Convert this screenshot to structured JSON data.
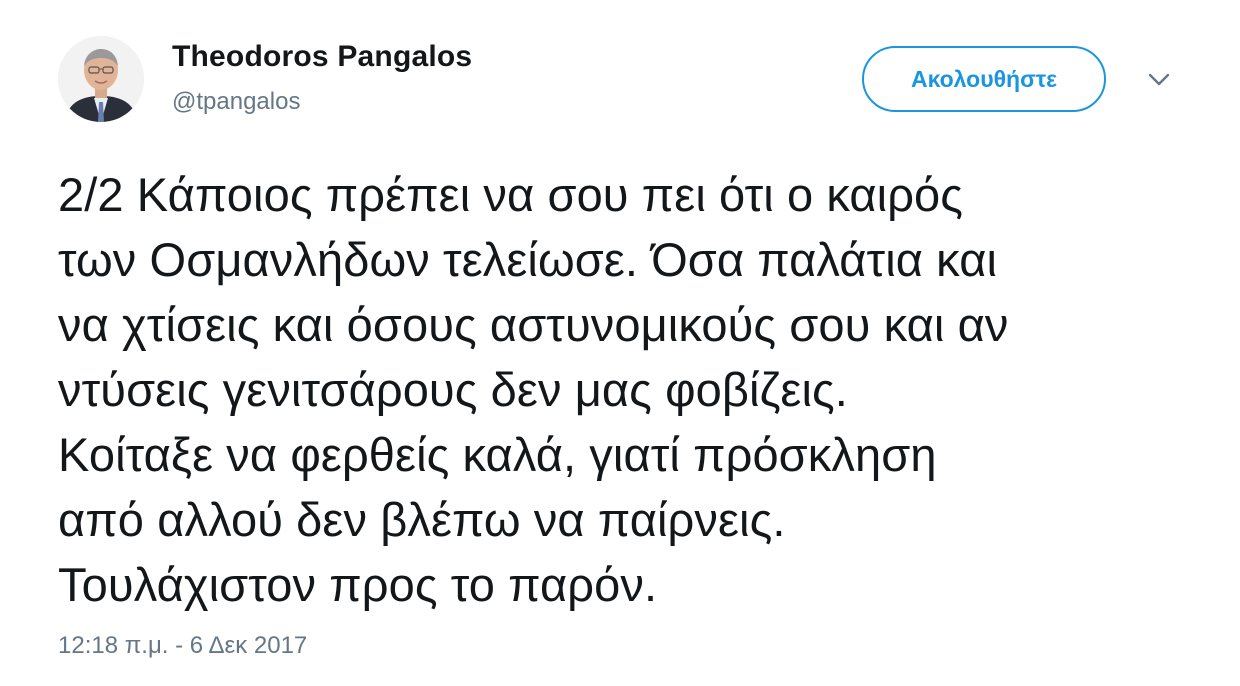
{
  "author": {
    "name": "Theodoros Pangalos",
    "handle": "@tpangalos",
    "avatar_icon": "profile-photo"
  },
  "actions": {
    "follow_label": "Ακολουθήστε",
    "more_icon": "chevron-down-icon"
  },
  "tweet": {
    "lines": [
      "2/2 Κάποιος πρέπει να σου πει ότι ο καιρός",
      "των Οσμανλήδων τελείωσε. Όσα παλάτια και",
      "να χτίσεις και όσους αστυνομικούς σου και αν",
      "ντύσεις γενιτσάρους δεν μας φοβίζεις.",
      "Κοίταξε να φερθείς καλά, γιατί πρόσκληση",
      "από αλλού δεν βλέπω να παίρνεις.",
      "Τουλάχιστον προς το παρόν."
    ],
    "timestamp": "12:18 π.μ. - 6 Δεκ 2017"
  },
  "colors": {
    "accent": "#1b95e0",
    "text": "#14171a",
    "secondary": "#657786"
  }
}
